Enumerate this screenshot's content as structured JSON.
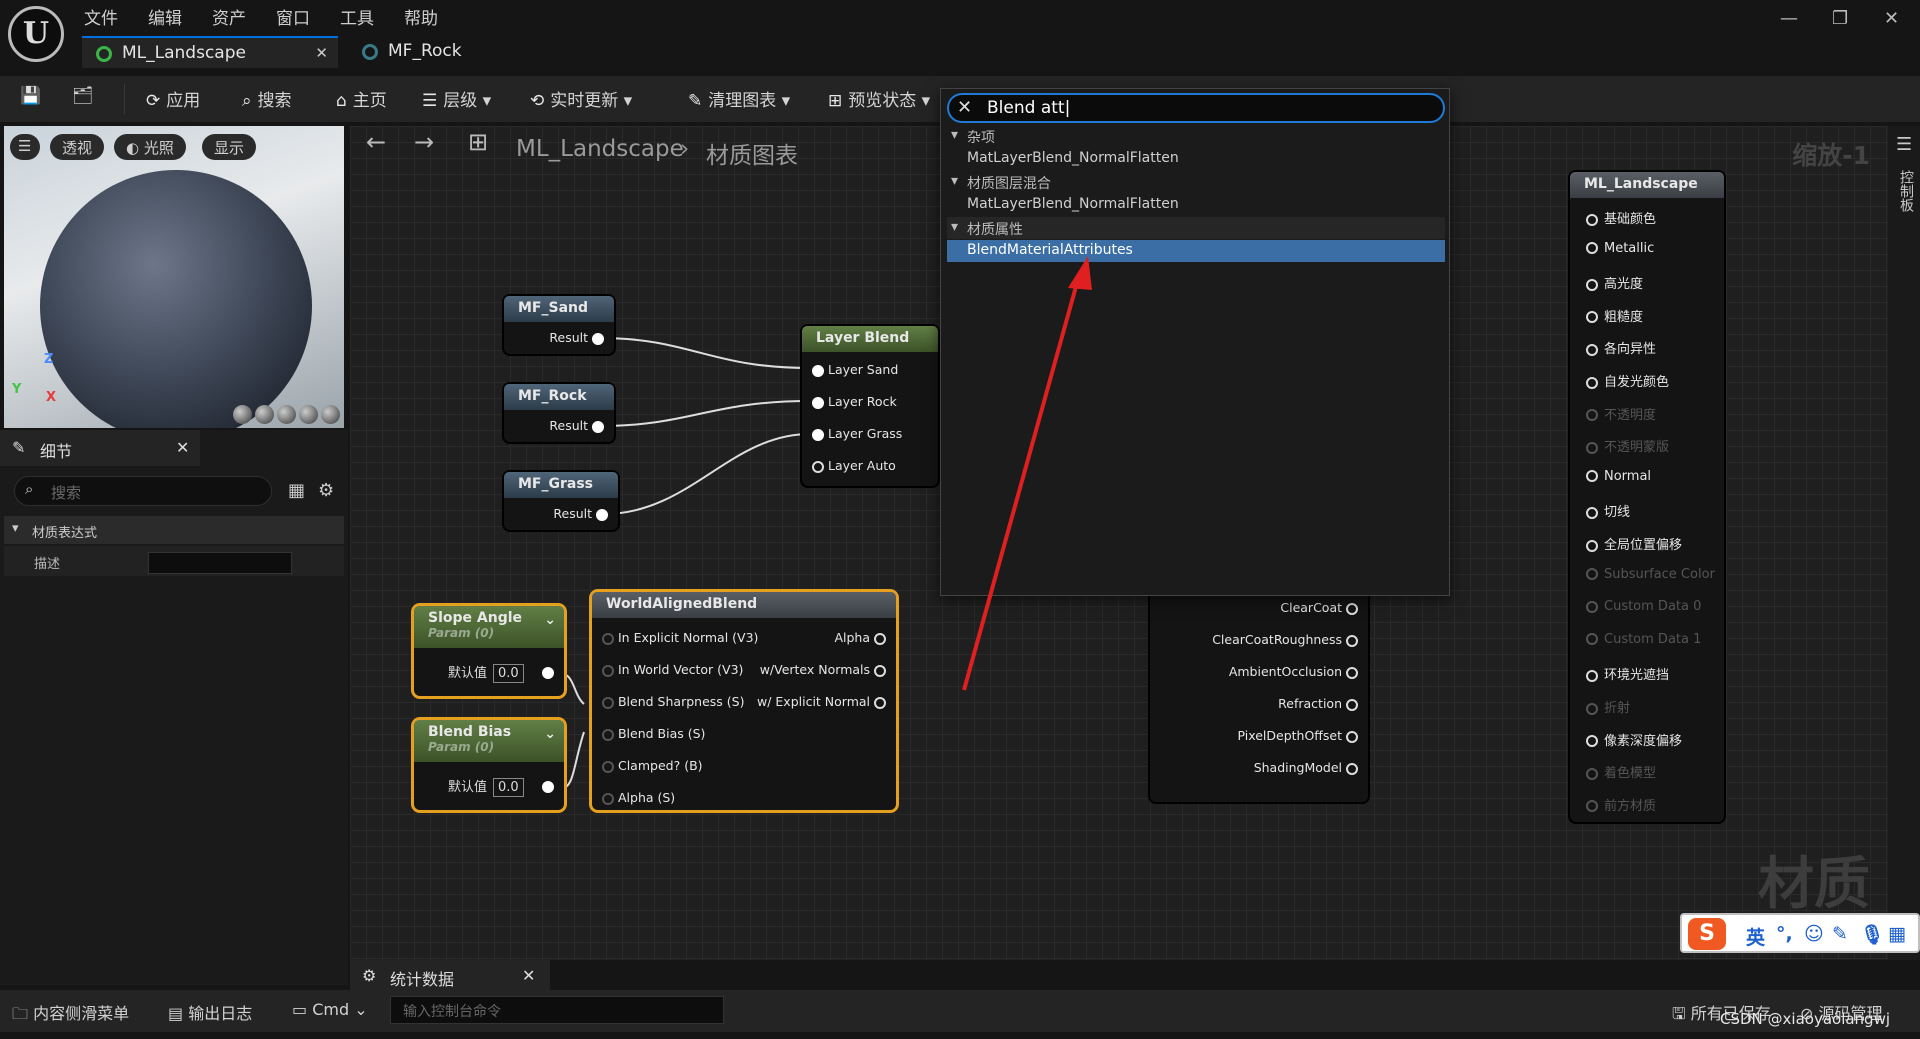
{
  "menu": {
    "items": [
      "文件",
      "编辑",
      "资产",
      "窗口",
      "工具",
      "帮助"
    ]
  },
  "tabs": [
    {
      "label": "ML_Landscape"
    },
    {
      "label": "MF_Rock"
    }
  ],
  "toolbar": {
    "apply": "应用",
    "search": "搜索",
    "home": "主页",
    "hierarchy": "层级",
    "live_update": "实时更新",
    "clean_graph": "清理图表",
    "preview_state": "预览状态"
  },
  "viewport": {
    "buttons": [
      "透视",
      "光照",
      "显示"
    ],
    "axis_z": "Z",
    "axis_y": "Y",
    "axis_x": "X"
  },
  "details": {
    "title": "细节",
    "search_placeholder": "搜索",
    "category": "材质表达式",
    "prop_label": "描述",
    "prop_value": ""
  },
  "graph": {
    "breadcrumb_root": "ML_Landscape",
    "breadcrumb_leaf": "材质图表",
    "zoom": "缩放-1",
    "watermark": "材质"
  },
  "nodes": {
    "mf_sand": {
      "title": "MF_Sand",
      "out": "Result"
    },
    "mf_rock": {
      "title": "MF_Rock",
      "out": "Result"
    },
    "mf_grass": {
      "title": "MF_Grass",
      "out": "Result"
    },
    "layer_blend": {
      "title": "Layer Blend",
      "pins": [
        "Layer Sand",
        "Layer Rock",
        "Layer Grass",
        "Layer Auto"
      ]
    },
    "slope_angle": {
      "title": "Slope Angle",
      "sub": "Param (0)",
      "default_label": "默认值",
      "value": "0.0"
    },
    "blend_bias": {
      "title": "Blend Bias",
      "sub": "Param (0)",
      "default_label": "默认值",
      "value": "0.0"
    },
    "world_aligned": {
      "title": "WorldAlignedBlend",
      "inputs": [
        "In Explicit Normal (V3)",
        "In World Vector (V3)",
        "Blend Sharpness (S)",
        "Blend Bias (S)",
        "Clamped? (B)",
        "Alpha (S)"
      ],
      "outputs": [
        "Alpha",
        "w/Vertex Normals",
        "w/ Explicit Normal"
      ]
    },
    "partial_outputs": [
      "ClearCoat",
      "ClearCoatRoughness",
      "AmbientOcclusion",
      "Refraction",
      "PixelDepthOffset",
      "ShadingModel"
    ],
    "result": {
      "title": "ML_Landscape",
      "pins": [
        {
          "label": "基础颜色",
          "on": true
        },
        {
          "label": "Metallic",
          "on": true
        },
        {
          "label": "高光度",
          "on": true
        },
        {
          "label": "粗糙度",
          "on": true
        },
        {
          "label": "各向异性",
          "on": true
        },
        {
          "label": "自发光颜色",
          "on": true
        },
        {
          "label": "不透明度",
          "on": false
        },
        {
          "label": "不透明蒙版",
          "on": false
        },
        {
          "label": "Normal",
          "on": true
        },
        {
          "label": "切线",
          "on": true
        },
        {
          "label": "全局位置偏移",
          "on": true
        },
        {
          "label": "Subsurface Color",
          "on": false
        },
        {
          "label": "Custom Data 0",
          "on": false
        },
        {
          "label": "Custom Data 1",
          "on": false
        },
        {
          "label": "环境光遮挡",
          "on": true
        },
        {
          "label": "折射",
          "on": false
        },
        {
          "label": "像素深度偏移",
          "on": true
        },
        {
          "label": "着色模型",
          "on": false
        },
        {
          "label": "前方材质",
          "on": false
        }
      ]
    }
  },
  "popup": {
    "query": "Blend att",
    "groups": [
      {
        "category": "杂项",
        "item": "MatLayerBlend_NormalFlatten"
      },
      {
        "category": "材质图层混合",
        "item": "MatLayerBlend_NormalFlatten"
      },
      {
        "category": "材质属性",
        "item": "BlendMaterialAttributes"
      }
    ]
  },
  "right_rail": {
    "label": "控制板"
  },
  "stats_tab": {
    "label": "统计数据"
  },
  "statusbar": {
    "content_drawer": "内容侧滑菜单",
    "output_log": "输出日志",
    "cmd": "Cmd",
    "console_placeholder": "输入控制台命令",
    "all_saved": "所有已保存",
    "source_control": "源码管理"
  },
  "ime": {
    "lang": "英"
  },
  "watermark_credit": "CSDN @xiaoyaolangwj",
  "colors": {
    "accent": "#1d7bd6",
    "selection": "#e6a020",
    "arrow": "#e02020"
  }
}
